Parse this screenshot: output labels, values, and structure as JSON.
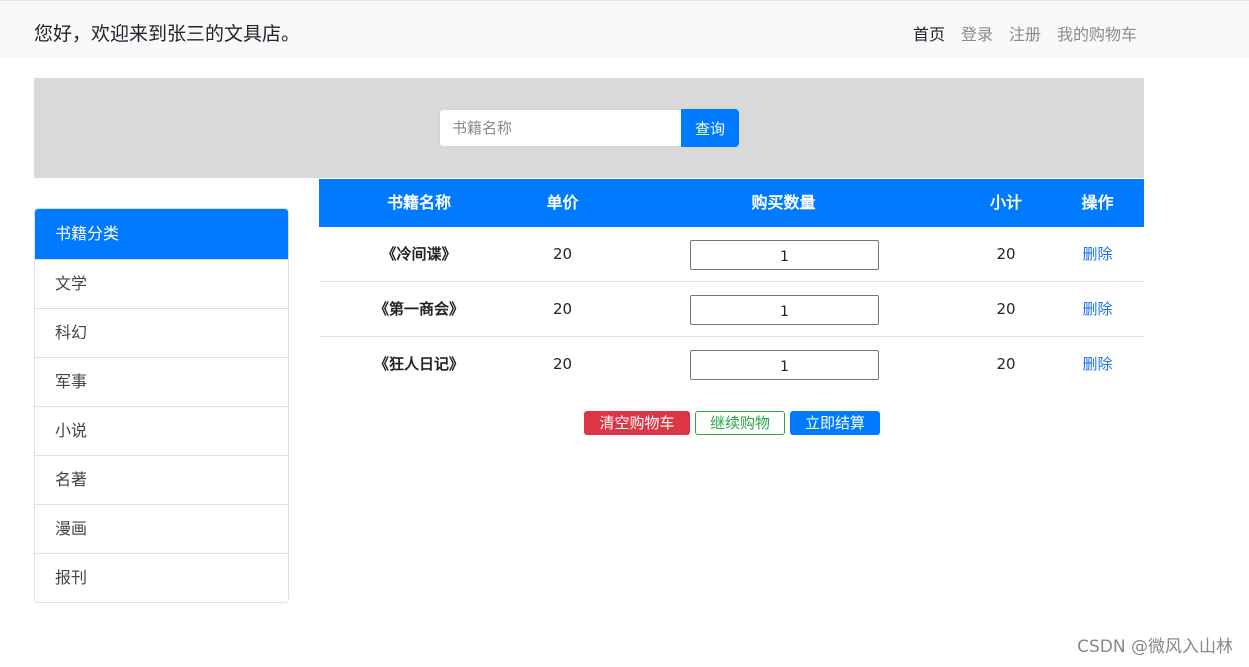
{
  "header": {
    "brand": "您好，欢迎来到张三的文具店。",
    "nav": [
      "首页",
      "登录",
      "注册",
      "我的购物车"
    ]
  },
  "search": {
    "placeholder": "书籍名称",
    "button": "查询"
  },
  "sidebar": {
    "title": "书籍分类",
    "items": [
      "文学",
      "科幻",
      "军事",
      "小说",
      "名著",
      "漫画",
      "报刊"
    ]
  },
  "cart": {
    "columns": [
      "书籍名称",
      "单价",
      "购买数量",
      "小计",
      "操作"
    ],
    "rows": [
      {
        "name": "《冷间谍》",
        "price": "20",
        "qty": "1",
        "subtotal": "20",
        "action": "删除"
      },
      {
        "name": "《第一商会》",
        "price": "20",
        "qty": "1",
        "subtotal": "20",
        "action": "删除"
      },
      {
        "name": "《狂人日记》",
        "price": "20",
        "qty": "1",
        "subtotal": "20",
        "action": "删除"
      }
    ]
  },
  "actions": {
    "clear": "清空购物车",
    "continue": "继续购物",
    "checkout": "立即结算"
  },
  "watermark": "CSDN @微风入山林",
  "colors": {
    "primary": "#007bff",
    "danger": "#dc3545",
    "success": "#28a745",
    "search_band": "#d9d9d9"
  }
}
